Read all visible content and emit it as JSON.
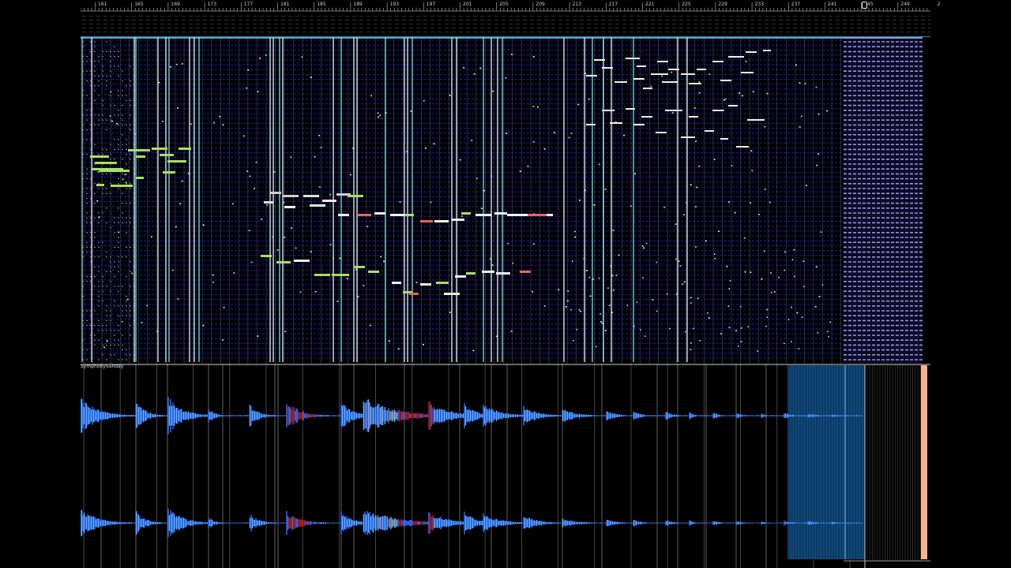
{
  "ruler": {
    "bar_numbers": [
      "161",
      "165",
      "169",
      "173",
      "177",
      "181",
      "185",
      "189",
      "193",
      "197",
      "201",
      "205",
      "209",
      "213",
      "217",
      "221",
      "225",
      "229",
      "233",
      "237",
      "241",
      "245",
      "249",
      "2"
    ]
  },
  "audio_track": {
    "name": "SymphonySunday"
  },
  "colors": {
    "background": "#000000",
    "note_grid": "#1a1ad8",
    "waveform": "#2a6bff",
    "waveform_light": "#5fb0ff",
    "waveform_red": "#b01a1a",
    "note_green": "#a8e060",
    "note_white": "#f0f0f0",
    "loop_region": "#0a3a66",
    "right_edge": "#f6b48a"
  }
}
